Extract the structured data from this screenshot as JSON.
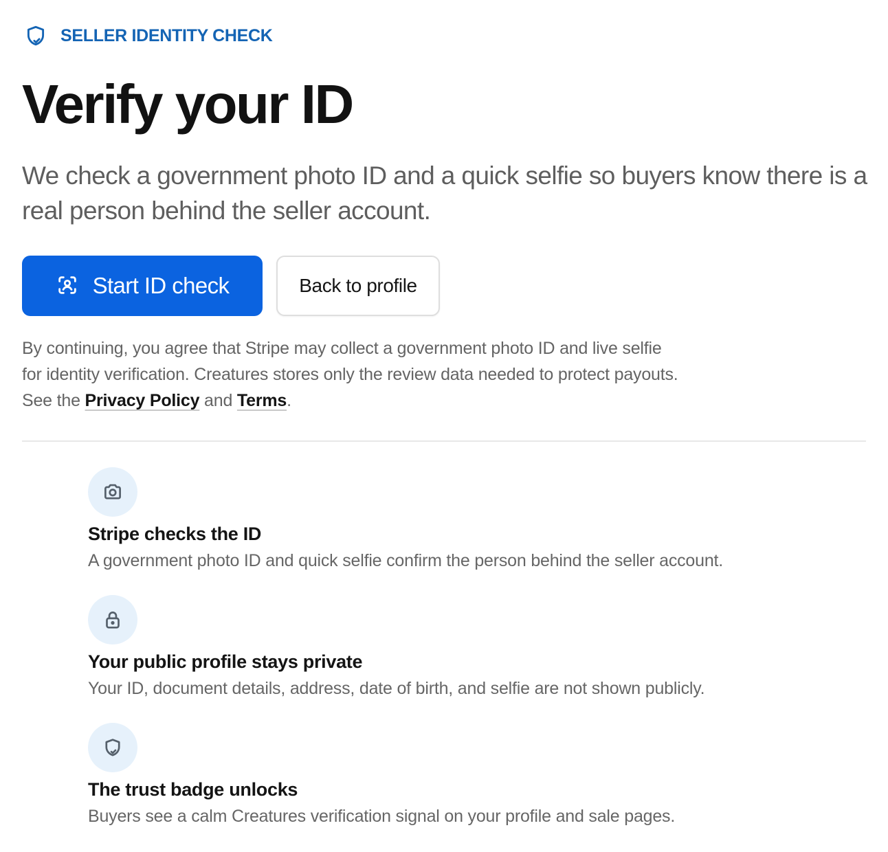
{
  "eyebrow": {
    "icon": "shield-check-icon",
    "label": "SELLER IDENTITY CHECK"
  },
  "title": "Verify your ID",
  "lead": "We check a government photo ID and a quick selfie so buyers know there is a real person behind the seller account.",
  "actions": {
    "primary": {
      "icon": "face-scan-icon",
      "label": "Start ID check"
    },
    "secondary": {
      "label": "Back to profile"
    }
  },
  "consent": {
    "text_before": "By continuing, you agree that Stripe may collect a government photo ID and live selfie for identity verification. Creatures stores only the review data needed to protect payouts. See the ",
    "privacy_link": "Privacy Policy",
    "middle": " and ",
    "terms_link": "Terms",
    "text_after": "."
  },
  "features": [
    {
      "icon": "camera-icon",
      "title": "Stripe checks the ID",
      "text": "A government photo ID and quick selfie confirm the person behind the seller account."
    },
    {
      "icon": "lock-icon",
      "title": "Your public profile stays private",
      "text": "Your ID, document details, address, date of birth, and selfie are not shown publicly."
    },
    {
      "icon": "shield-check-icon",
      "title": "The trust badge unlocks",
      "text": "Buyers see a calm Creatures verification signal on your profile and sale pages."
    }
  ],
  "colors": {
    "accent": "#0b63e0",
    "eyebrow": "#1464b4",
    "icon_bg": "#e6f1fb"
  }
}
